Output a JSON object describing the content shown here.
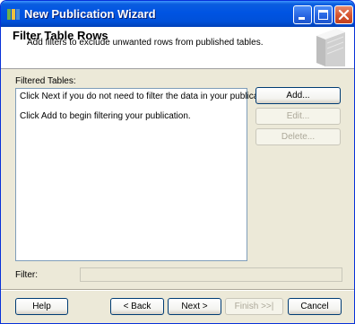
{
  "window": {
    "title": "New Publication Wizard",
    "accent": "#0054e3",
    "close_color": "#d5532e"
  },
  "header": {
    "title": "Filter Table Rows",
    "subtitle": "Add filters to exclude unwanted rows from published tables."
  },
  "filtered_tables": {
    "label": "Filtered Tables:",
    "lines": [
      "Click Next if you do not need to filter the data in your publication.",
      "Click Add to begin filtering your publication."
    ]
  },
  "side_buttons": {
    "add": "Add...",
    "edit": "Edit...",
    "delete": "Delete..."
  },
  "filter": {
    "label": "Filter:",
    "value": ""
  },
  "footer": {
    "help": "Help",
    "back": "< Back",
    "next": "Next >",
    "finish": "Finish >>|",
    "cancel": "Cancel"
  },
  "icons": [
    "wizard-app-icon",
    "minimize-icon",
    "maximize-icon",
    "close-icon",
    "publication-book-icon"
  ]
}
